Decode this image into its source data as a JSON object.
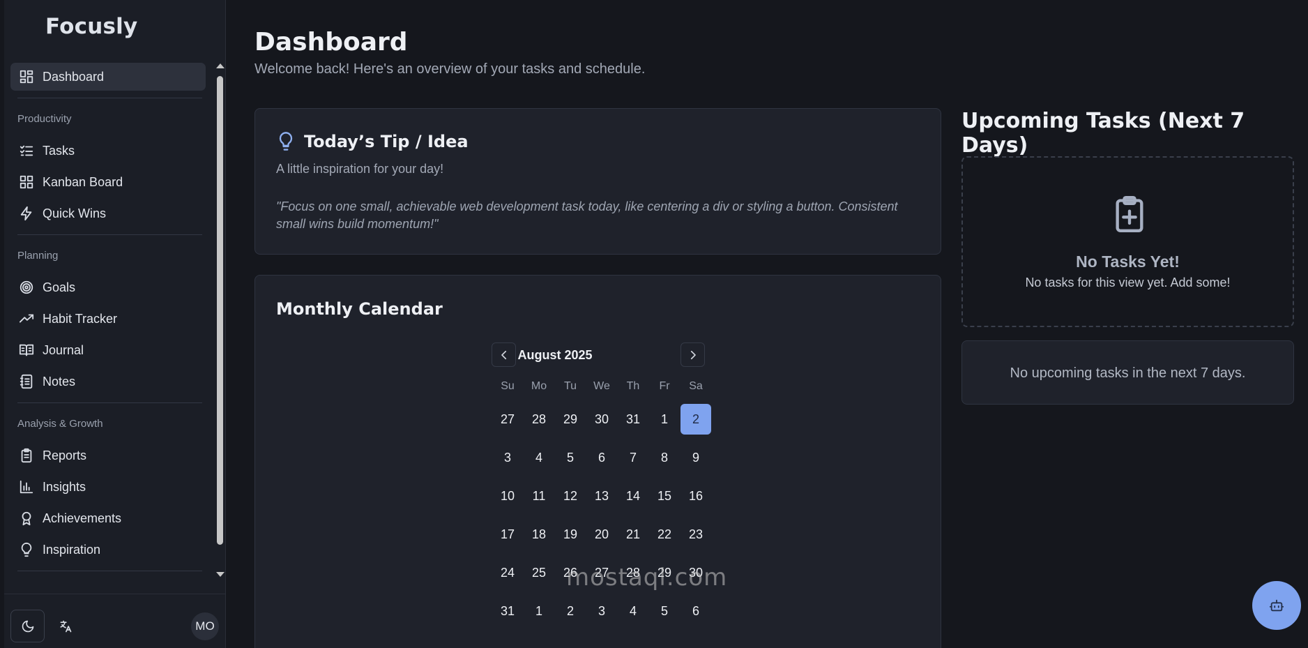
{
  "app": {
    "name": "Focusly"
  },
  "sidebar": {
    "dashboard": {
      "label": "Dashboard"
    },
    "sections": [
      {
        "title": "Productivity",
        "items": [
          {
            "label": "Tasks",
            "icon": "tasks-icon"
          },
          {
            "label": "Kanban Board",
            "icon": "kanban-icon"
          },
          {
            "label": "Quick Wins",
            "icon": "lightning-icon"
          }
        ]
      },
      {
        "title": "Planning",
        "items": [
          {
            "label": "Goals",
            "icon": "target-icon"
          },
          {
            "label": "Habit Tracker",
            "icon": "trending-up-icon"
          },
          {
            "label": "Journal",
            "icon": "book-icon"
          },
          {
            "label": "Notes",
            "icon": "notebook-icon"
          }
        ]
      },
      {
        "title": "Analysis & Growth",
        "items": [
          {
            "label": "Reports",
            "icon": "clipboard-icon"
          },
          {
            "label": "Insights",
            "icon": "bar-chart-icon"
          },
          {
            "label": "Achievements",
            "icon": "award-icon"
          },
          {
            "label": "Inspiration",
            "icon": "lightbulb-icon"
          }
        ]
      }
    ],
    "footer": {
      "avatar": "MO"
    }
  },
  "header": {
    "title": "Dashboard",
    "subtitle": "Welcome back! Here's an overview of your tasks and schedule."
  },
  "tip": {
    "title": "Today’s Tip / Idea",
    "subtitle": "A little inspiration for your day!",
    "quote": "\"Focus on one small, achievable web development task today, like centering a div or styling a button. Consistent small wins build momentum!\""
  },
  "calendar": {
    "title": "Monthly Calendar",
    "month": "August 2025",
    "weekdays": [
      "Su",
      "Mo",
      "Tu",
      "We",
      "Th",
      "Fr",
      "Sa"
    ],
    "weeks": [
      [
        "27",
        "28",
        "29",
        "30",
        "31",
        "1",
        "2"
      ],
      [
        "3",
        "4",
        "5",
        "6",
        "7",
        "8",
        "9"
      ],
      [
        "10",
        "11",
        "12",
        "13",
        "14",
        "15",
        "16"
      ],
      [
        "17",
        "18",
        "19",
        "20",
        "21",
        "22",
        "23"
      ],
      [
        "24",
        "25",
        "26",
        "27",
        "28",
        "29",
        "30"
      ],
      [
        "31",
        "1",
        "2",
        "3",
        "4",
        "5",
        "6"
      ]
    ],
    "selected": "2"
  },
  "upcoming": {
    "title": "Upcoming Tasks (Next 7 Days)",
    "empty_title": "No Tasks Yet!",
    "empty_sub": "No tasks for this view yet. Add some!",
    "none_text": "No upcoming tasks in the next 7 days."
  },
  "watermark": "mostaql.com",
  "colors": {
    "accent": "#7fa3ef",
    "background": "#15171d",
    "card": "#1f222b"
  }
}
